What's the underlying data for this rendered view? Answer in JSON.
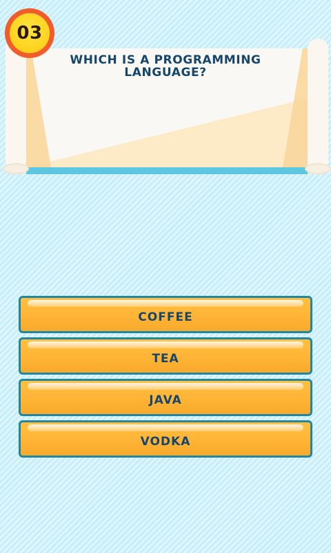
{
  "question": {
    "number": "03",
    "text": "WHICH IS A PROGRAMMING LANGUAGE?"
  },
  "answers": [
    {
      "label": "COFFEE"
    },
    {
      "label": "TEA"
    },
    {
      "label": "JAVA"
    },
    {
      "label": "VODKA"
    }
  ],
  "colors": {
    "background_stripe_light": "#def6fc",
    "background_stripe_dark": "#c6edf8",
    "button_fill": "#ffb436",
    "button_border": "#1f86a5",
    "text": "#17466b",
    "badge_ring": "#f05d2a",
    "badge_fill": "#ffd21e"
  }
}
